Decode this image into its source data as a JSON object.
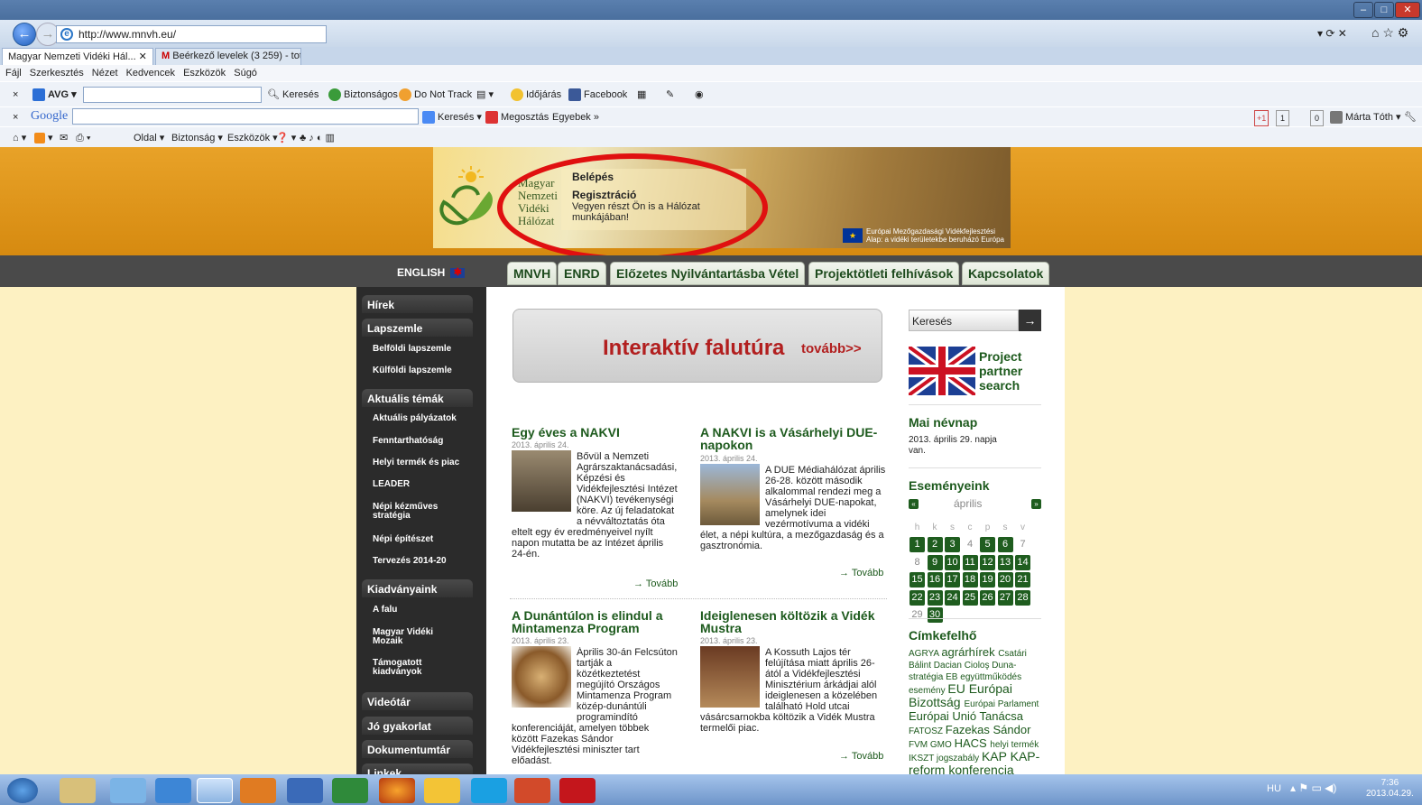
{
  "browser": {
    "url": "http://www.mnvh.eu/",
    "tabs": [
      {
        "label": "Magyar Nemzeti Vidéki Hál...",
        "active": true
      },
      {
        "label": "Beérkező levelek (3 259) - toth...",
        "active": false
      }
    ],
    "menu": [
      "Fájl",
      "Szerkesztés",
      "Nézet",
      "Kedvencek",
      "Eszközök",
      "Súgó"
    ],
    "toolbar1": {
      "avg": "AVG",
      "search": "Keresés",
      "security": "Biztonságos",
      "dnt": "Do Not Track",
      "weather": "Időjárás",
      "facebook": "Facebook"
    },
    "toolbar2": {
      "google": "Google",
      "search": "Keresés",
      "share": "Megosztás",
      "more": "Egyebek »",
      "gplus": "+1",
      "count1": "1",
      "count2": "0",
      "user": "Márta Tóth"
    },
    "toolbar3": {
      "page": "Oldal",
      "security": "Biztonság",
      "tools": "Eszközök"
    }
  },
  "banner": {
    "logo_lines": [
      "Magyar",
      "Nemzeti",
      "Vidéki",
      "Hálózat"
    ],
    "login": "Belépés",
    "register": "Regisztráció",
    "register_sub": "Vegyen részt Ön is a Hálózat munkájában!",
    "eu_text": "Európai Mezőgazdasági Vidékfejlesztési Alap: a vidéki területekbe beruházó Európa"
  },
  "nav": {
    "english": "ENGLISH",
    "tabs": [
      "MNVH",
      "ENRD",
      "Előzetes Nyilvántartásba Vétel",
      "Projektötleti felhívások",
      "Kapcsolatok"
    ]
  },
  "sidebar": {
    "headers": [
      "Hírek",
      "Lapszemle",
      "Aktuális témák",
      "Kiadványaink",
      "Videótár",
      "Jó gyakorlat",
      "Dokumentumtár",
      "Linkek"
    ],
    "lapszemle": [
      "Belföldi lapszemle",
      "Külföldi lapszemle"
    ],
    "temak": [
      "Aktuális pályázatok",
      "Fenntarthatóság",
      "Helyi termék és piac",
      "LEADER",
      "Népi kézműves stratégia",
      "Népi építészet",
      "Tervezés 2014-20"
    ],
    "kiadvanyok": [
      "A falu",
      "Magyar Vidéki Mozaik",
      "Támogatott kiadványok"
    ]
  },
  "promo": {
    "title": "Interaktív falutúra",
    "more": "tovább>>"
  },
  "news": [
    {
      "title": "Egy éves a NAKVI",
      "date": "2013. április 24.",
      "text": "Bővül a Nemzeti Agrárszaktanácsadási, Képzési és Vidékfejlesztési Intézet (NAKVI) tevékenységi köre. Az új feladatokat a névváltoztatás óta eltelt egy év eredményeivel nyílt napon mutatta be az Intézet április 24-én.",
      "more": "→ Tovább"
    },
    {
      "title": "A NAKVI is a Vásárhelyi DUE-napokon",
      "date": "2013. április 24.",
      "text": "A DUE Médiahálózat április 26-28. között második alkalommal rendezi meg a Vásárhelyi DUE-napokat, amelynek idei vezérmotívuma a vidéki élet, a népi kultúra, a mezőgazdaság és a gasztronómia.",
      "more": "→ Tovább"
    },
    {
      "title": "A Dunántúlon is elindul a Mintamenza Program",
      "date": "2013. április 23.",
      "text": "Április 30-án Felcsúton tartják a közétkeztetést megújító Országos Mintamenza Program közép-dunántúli programindító konferenciáját, amelyen többek között Fazekas Sándor Vidékfejlesztési miniszter tart előadást.",
      "more": ""
    },
    {
      "title": "Ideiglenesen költözik a Vidék Mustra",
      "date": "2013. április 23.",
      "text": "A Kossuth Lajos tér felújítása miatt április 26-ától a Vidékfejlesztési Minisztérium árkádjai alól ideiglenesen a közelében található Hold utcai vásárcsarnokba költözik a Vidék Mustra termelői piac.",
      "more": "→ Tovább"
    }
  ],
  "right": {
    "search_placeholder": "Keresés",
    "project": "Project partner search",
    "nevnap_title": "Mai névnap",
    "nevnap_text": "2013. április 29. napja van.",
    "esemeny_title": "Eseményeink",
    "month": "április",
    "weekdays": [
      "h",
      "k",
      "s",
      "c",
      "p",
      "s",
      "v"
    ],
    "days": [
      [
        "1",
        "2",
        "3",
        "4",
        "5",
        "6",
        "7"
      ],
      [
        "8",
        "9",
        "10",
        "11",
        "12",
        "13",
        "14"
      ],
      [
        "15",
        "16",
        "17",
        "18",
        "19",
        "20",
        "21"
      ],
      [
        "22",
        "23",
        "24",
        "25",
        "26",
        "27",
        "28"
      ],
      [
        "29",
        "30"
      ]
    ],
    "cimke_title": "Címkefelhő",
    "tags": "AGRYA agrárhírek Csatári Bálint Dacian Cioloş Duna-stratégia EB együttműködés esemény EU Európai Bizottság Európai Parlament Európai Unió Tanácsa FATOSZ Fazekas Sándor FVM GMO HACS helyi termék IKSZT jogszabály KAP KAP-reform konferencia"
  },
  "taskbar": {
    "lang": "HU",
    "time": "7:36",
    "date": "2013.04.29."
  }
}
